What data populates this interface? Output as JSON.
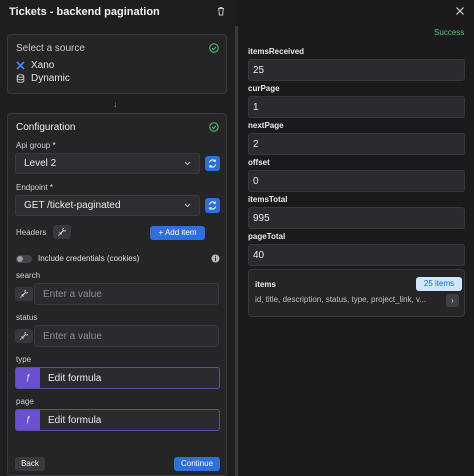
{
  "left_panel": {
    "title": "Tickets - backend pagination",
    "source": {
      "title": "Select a source",
      "items": [
        {
          "label": "Xano",
          "icon": "xano-icon"
        },
        {
          "label": "Dynamic",
          "icon": "database-icon"
        }
      ]
    },
    "configuration": {
      "title": "Configuration",
      "api_group": {
        "label": "Api group",
        "required_mark": "*",
        "value": "Level 2"
      },
      "endpoint": {
        "label": "Endpoint",
        "required_mark": "*",
        "value": "GET /ticket-paginated"
      },
      "headers": {
        "label": "Headers",
        "add_label": "Add item"
      },
      "credentials": {
        "label": "Include credentials (cookies)",
        "enabled": false
      },
      "search": {
        "label": "search",
        "placeholder": "Enter a value"
      },
      "status": {
        "label": "status",
        "placeholder": "Enter a value"
      },
      "type": {
        "label": "type",
        "formula_label": "Edit formula"
      },
      "page": {
        "label": "page",
        "formula_label": "Edit formula"
      }
    },
    "back_label": "Back",
    "continue_label": "Continue"
  },
  "right_panel": {
    "status": "Success",
    "fields": [
      {
        "name": "itemsReceived",
        "value": "25"
      },
      {
        "name": "curPage",
        "value": "1"
      },
      {
        "name": "nextPage",
        "value": "2"
      },
      {
        "name": "offset",
        "value": "0"
      },
      {
        "name": "itemsTotal",
        "value": "995"
      },
      {
        "name": "pageTotal",
        "value": "40"
      }
    ],
    "items": {
      "title": "items",
      "badge": "25 items",
      "fields": "id, title, description, status, type, project_link, v..."
    }
  },
  "colors": {
    "accent_blue": "#2f6fd8",
    "success_green": "#55c27a",
    "formula_purple": "#6b4fd1",
    "badge_bg": "#cfe6fb",
    "badge_text": "#2266c9"
  }
}
